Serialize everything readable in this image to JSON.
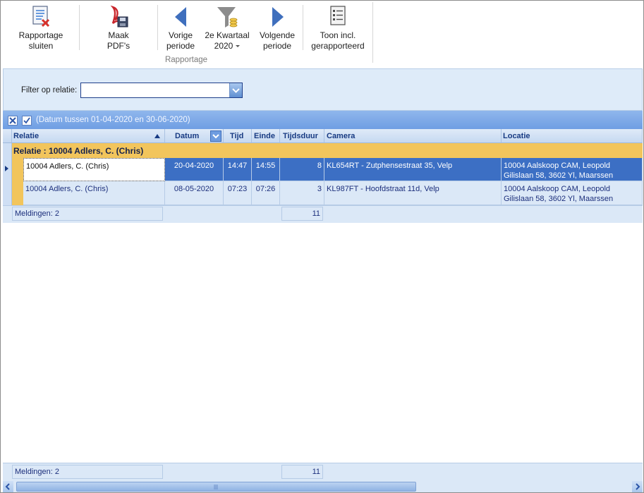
{
  "ribbon": {
    "buttons": [
      {
        "id": "close",
        "label": "Rapportage\nsluiten",
        "icon": "close-report-icon"
      },
      {
        "id": "pdf",
        "label": "Maak\nPDF's",
        "icon": "pdf-save-icon"
      },
      {
        "id": "prev",
        "label": "Vorige\nperiode",
        "icon": "arrow-left-icon"
      },
      {
        "id": "period",
        "label": "2e Kwartaal\n2020",
        "icon": "filter-funnel-icon"
      },
      {
        "id": "next",
        "label": "Volgende\nperiode",
        "icon": "arrow-right-icon"
      },
      {
        "id": "show",
        "label": "Toon incl.\ngerapporteerd",
        "icon": "report-list-icon"
      }
    ],
    "group_label": "Rapportage"
  },
  "filter": {
    "label": "Filter op relatie:",
    "value": ""
  },
  "filterbar": {
    "text": "(Datum tussen 01-04-2020 en 30-06-2020)"
  },
  "grid": {
    "columns": [
      "Relatie",
      "Datum",
      "Tijd",
      "Einde",
      "Tijdsduur",
      "Camera",
      "Locatie"
    ],
    "group_row": "Relatie : 10004 Adlers, C. (Chris)",
    "rows": [
      {
        "relatie": "10004 Adlers, C. (Chris)",
        "datum": "20-04-2020",
        "tijd": "14:47",
        "einde": "14:55",
        "tijdsduur": "8",
        "camera": "KL654RT - Zutphensestraat 35, Velp",
        "locatie": "10004 Aalskoop CAM, Leopold Gilislaan 58, 3602 Yl, Maarssen"
      },
      {
        "relatie": "10004 Adlers, C. (Chris)",
        "datum": "08-05-2020",
        "tijd": "07:23",
        "einde": "07:26",
        "tijdsduur": "3",
        "camera": "KL987FT - Hoofdstraat 11d, Velp",
        "locatie": "10004 Aalskoop CAM, Leopold Gilislaan 58, 3602 Yl, Maarssen"
      }
    ],
    "group_footer": {
      "count": "Meldingen: 2",
      "sum": "11"
    },
    "footer": {
      "count": "Meldingen: 2",
      "sum": "11"
    }
  },
  "colors": {
    "selected": "#3c6fc4",
    "group": "#f2c55c",
    "header_text": "#173a82"
  }
}
